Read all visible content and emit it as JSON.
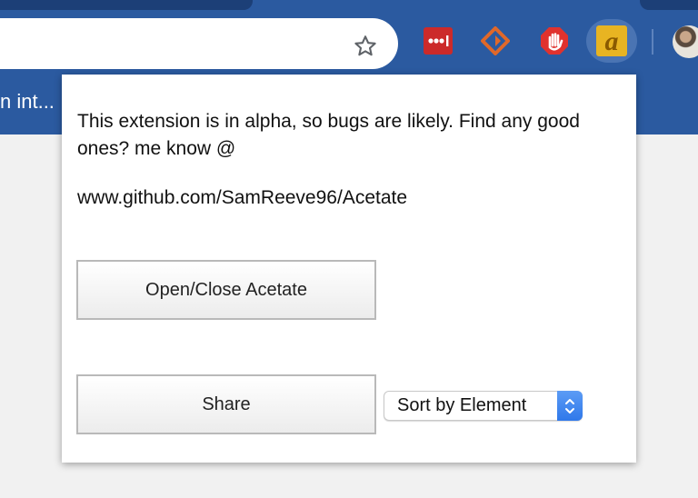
{
  "browser": {
    "tab_title_truncated": "n int...",
    "toolbar_icons": [
      "star-icon",
      "lastpass-icon",
      "diamond-extension-icon",
      "adblock-icon",
      "acetate-icon"
    ],
    "colors": {
      "chrome_blue": "#2b5aa0",
      "tab_dark": "#1c3f77",
      "lastpass_red": "#cc2a2a",
      "diamond_orange": "#e0682a",
      "adblock_red": "#e0322e",
      "acetate_gold": "#e8b422",
      "select_blue": "#2f78ea"
    }
  },
  "popup": {
    "notice": "This extension is in alpha, so bugs are likely. Find any good ones? me know @",
    "repo_url": "www.github.com/SamReeve96/Acetate",
    "open_close_label": "Open/Close Acetate",
    "share_label": "Share",
    "sort_select": {
      "selected": "Sort by Element"
    }
  }
}
